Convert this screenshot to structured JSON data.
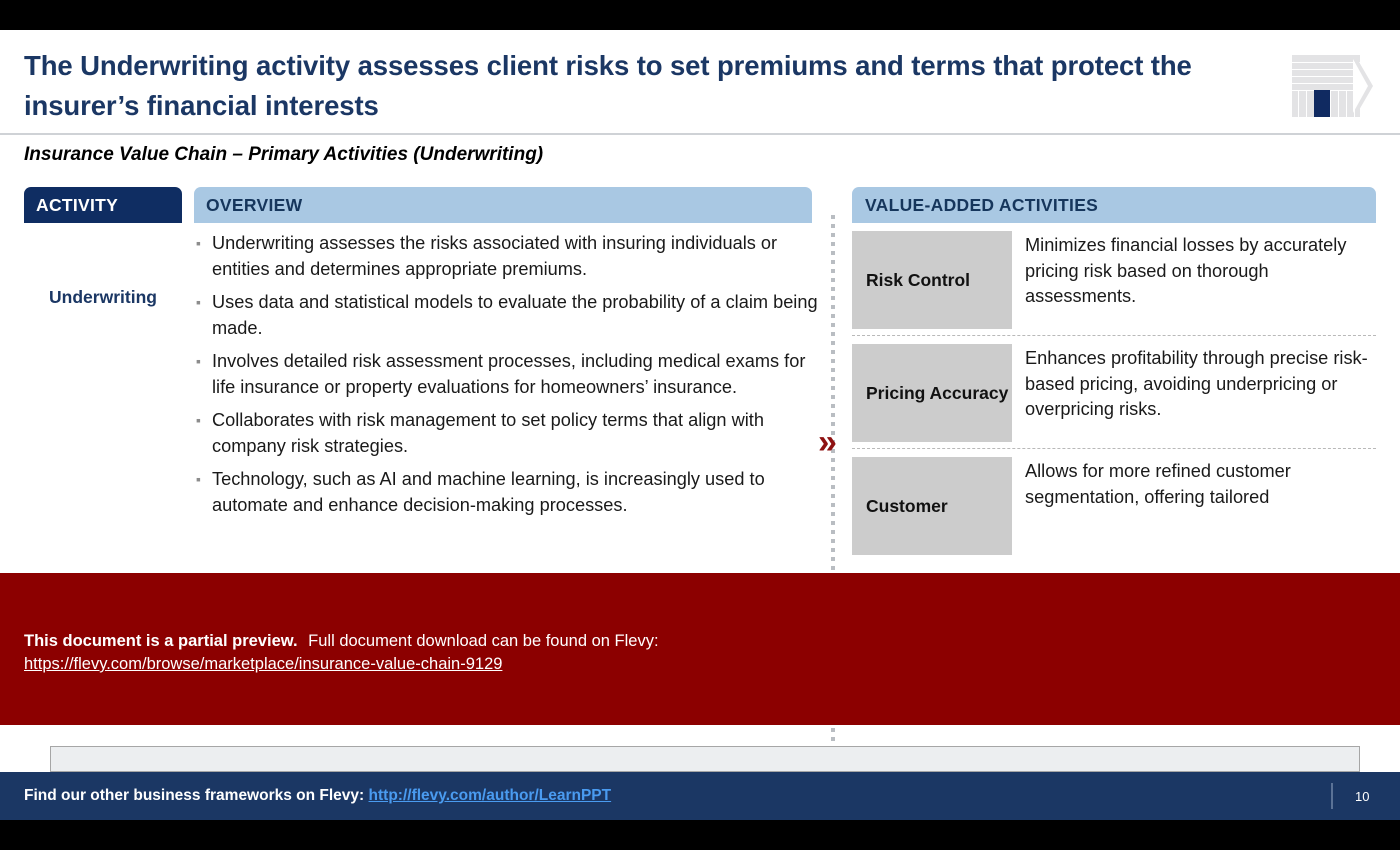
{
  "header": {
    "title": "The Underwriting activity assesses client risks to set premiums and terms that protect the insurer’s financial interests",
    "subtitle": "Insurance Value Chain – Primary Activities (Underwriting)",
    "logo_icon": "flevy-building-logo"
  },
  "left_column": {
    "activity_header": "ACTIVITY",
    "overview_header": "OVERVIEW",
    "activity_name": "Underwriting",
    "bullet_marker": "▪",
    "bullets": [
      "Underwriting assesses the risks associated with insuring individuals or entities and determines appropriate premiums.",
      "Uses data and statistical models to evaluate the probability of a claim being made.",
      "Involves detailed risk assessment processes, including medical exams for life insurance or property evaluations for homeowners’ insurance.",
      "Collaborates with risk management to set policy terms that align with company risk strategies.",
      "Technology, such as AI and machine learning, is increasingly used to automate and enhance decision-making processes."
    ]
  },
  "divider": {
    "chevron_icon": "»"
  },
  "right_column": {
    "header": "VALUE-ADDED ACTIVITIES",
    "rows": [
      {
        "label": "Risk Control",
        "description": "Minimizes financial losses by accurately pricing risk based on thorough assessments."
      },
      {
        "label": "Pricing Accuracy",
        "description": "Enhances profitability through precise risk-based pricing, avoiding underpricing or overpricing risks."
      },
      {
        "label": "Customer",
        "description": "Allows for more refined customer segmentation, offering tailored"
      }
    ]
  },
  "preview_overlay": {
    "bold_text": "This document is a partial preview.",
    "normal_text": "Full document download can be found on Flevy:",
    "link": "https://flevy.com/browse/marketplace/insurance-value-chain-9129"
  },
  "footer": {
    "text": "Find our other business frameworks on Flevy:",
    "link": "http://flevy.com/author/LearnPPT",
    "page_number": "10"
  },
  "colors": {
    "navy": "#1b3764",
    "activity_chip": "#0f2d62",
    "light_blue": "#a9c8e3",
    "gray_box": "#cccccc",
    "red_overlay": "#8c0000",
    "chevron_red": "#8e1111",
    "footer_link": "#4a9bf0"
  }
}
